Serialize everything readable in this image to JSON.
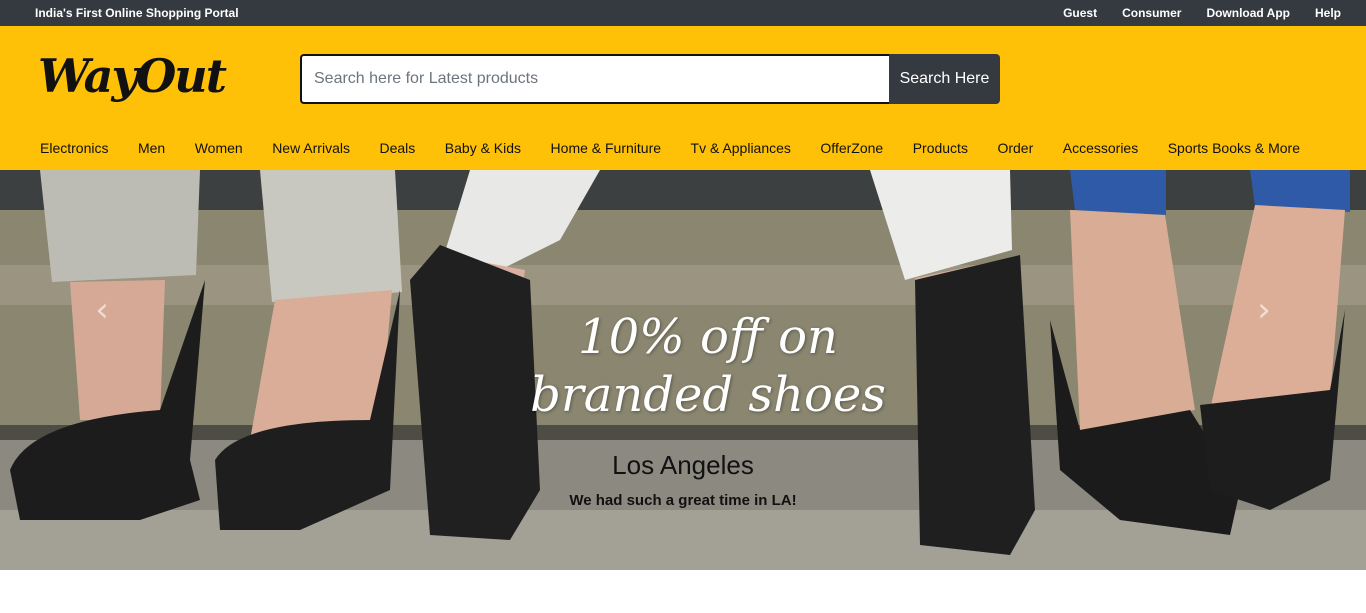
{
  "topbar": {
    "tagline": "India's First Online Shopping Portal",
    "links": [
      "Guest",
      "Consumer",
      "Download App",
      "Help"
    ]
  },
  "header": {
    "logo": "WayOut",
    "search": {
      "placeholder": "Search here for Latest products",
      "value": "",
      "button_label": "Search Here"
    }
  },
  "categories": [
    "Electronics",
    "Men",
    "Women",
    "New Arrivals",
    "Deals",
    "Baby & Kids",
    "Home & Furniture",
    "Tv & Appliances",
    "OfferZone",
    "Products",
    "Order",
    "Accessories",
    "Sports Books & More"
  ],
  "carousel": {
    "heading_line1": "10% off on",
    "heading_line2": "branded shoes",
    "caption_title": "Los Angeles",
    "caption_text": "We had such a great time in LA!",
    "prev_icon": "chevron-left-icon",
    "next_icon": "chevron-right-icon"
  },
  "colors": {
    "topbar_bg": "#343a40",
    "header_bg": "#ffc107",
    "button_bg": "#343a40"
  }
}
